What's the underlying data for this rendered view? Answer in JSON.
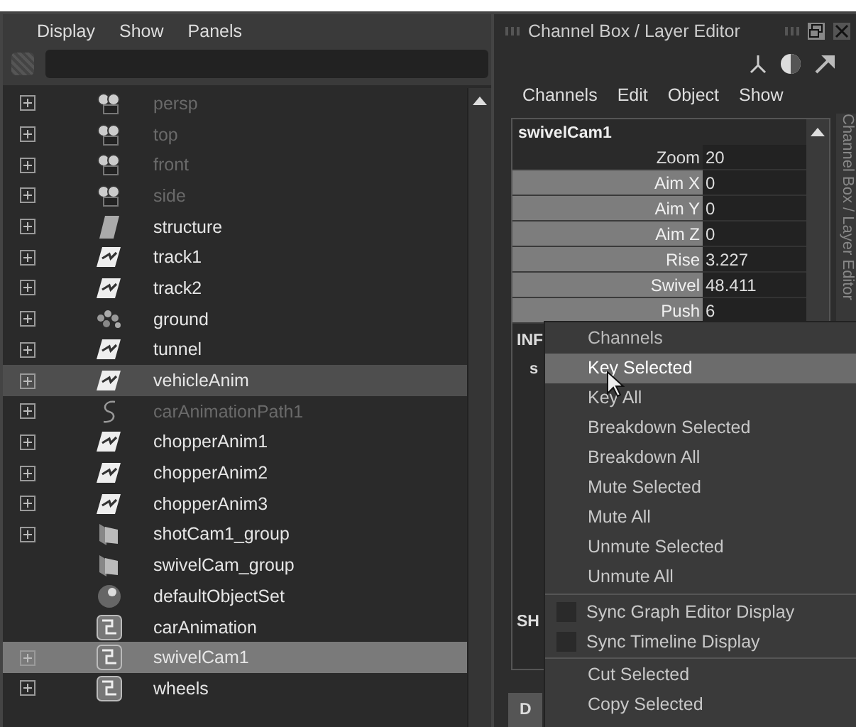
{
  "outliner": {
    "menu": [
      "Display",
      "Show",
      "Panels"
    ],
    "rows": [
      {
        "name": "persp",
        "kind": "camera",
        "expandable": true,
        "dimmed": true,
        "selected": false
      },
      {
        "name": "top",
        "kind": "camera",
        "expandable": true,
        "dimmed": true,
        "selected": false
      },
      {
        "name": "front",
        "kind": "camera",
        "expandable": true,
        "dimmed": true,
        "selected": false
      },
      {
        "name": "side",
        "kind": "camera",
        "expandable": true,
        "dimmed": true,
        "selected": false
      },
      {
        "name": "structure",
        "kind": "surface",
        "expandable": true,
        "dimmed": false,
        "selected": false
      },
      {
        "name": "track1",
        "kind": "transform",
        "expandable": true,
        "dimmed": false,
        "selected": false
      },
      {
        "name": "track2",
        "kind": "transform",
        "expandable": true,
        "dimmed": false,
        "selected": false
      },
      {
        "name": "ground",
        "kind": "particles",
        "expandable": true,
        "dimmed": false,
        "selected": false
      },
      {
        "name": "tunnel",
        "kind": "transform",
        "expandable": true,
        "dimmed": false,
        "selected": false
      },
      {
        "name": "vehicleAnim",
        "kind": "transform",
        "expandable": true,
        "dimmed": false,
        "selected": true
      },
      {
        "name": "carAnimationPath1",
        "kind": "curve",
        "expandable": true,
        "dimmed": true,
        "selected": false
      },
      {
        "name": "chopperAnim1",
        "kind": "transform",
        "expandable": true,
        "dimmed": false,
        "selected": false
      },
      {
        "name": "chopperAnim2",
        "kind": "transform",
        "expandable": true,
        "dimmed": false,
        "selected": false
      },
      {
        "name": "chopperAnim3",
        "kind": "transform",
        "expandable": true,
        "dimmed": false,
        "selected": false
      },
      {
        "name": "shotCam1_group",
        "kind": "group",
        "expandable": true,
        "dimmed": false,
        "selected": false
      },
      {
        "name": "swivelCam_group",
        "kind": "group",
        "expandable": false,
        "dimmed": false,
        "selected": false
      },
      {
        "name": "defaultObjectSet",
        "kind": "set",
        "expandable": false,
        "dimmed": false,
        "selected": false
      },
      {
        "name": "carAnimation",
        "kind": "layer",
        "expandable": false,
        "dimmed": false,
        "selected": false
      },
      {
        "name": "swivelCam1",
        "kind": "layer",
        "expandable": true,
        "dimmed": false,
        "selected": true
      },
      {
        "name": "wheels",
        "kind": "layer",
        "expandable": true,
        "dimmed": false,
        "selected": false
      }
    ]
  },
  "channel_box": {
    "title": "Channel Box / Layer Editor",
    "side_tab": "Channel Box / Layer Editor",
    "menu": [
      "Channels",
      "Edit",
      "Object",
      "Show"
    ],
    "object": "swivelCam1",
    "channels": [
      {
        "name": "Zoom",
        "value": "20",
        "selected": false
      },
      {
        "name": "Aim X",
        "value": "0",
        "selected": true
      },
      {
        "name": "Aim Y",
        "value": "0",
        "selected": true
      },
      {
        "name": "Aim Z",
        "value": "0",
        "selected": true
      },
      {
        "name": "Rise",
        "value": "3.227",
        "selected": true
      },
      {
        "name": "Swivel",
        "value": "48.411",
        "selected": true
      },
      {
        "name": "Push",
        "value": "6",
        "selected": true
      }
    ],
    "inputs_label": "INF",
    "inputs_item": "s",
    "shapes_label": "SH",
    "bottom_tab": "D"
  },
  "context_menu": {
    "items": [
      {
        "kind": "header",
        "label": "Channels"
      },
      {
        "kind": "item",
        "label": "Key Selected",
        "selected": true
      },
      {
        "kind": "item",
        "label": "Key All",
        "selected": false
      },
      {
        "kind": "item",
        "label": "Breakdown Selected",
        "selected": false
      },
      {
        "kind": "item",
        "label": "Breakdown All",
        "selected": false
      },
      {
        "kind": "item",
        "label": "Mute Selected",
        "selected": false
      },
      {
        "kind": "item",
        "label": "Mute All",
        "selected": false
      },
      {
        "kind": "item",
        "label": "Unmute Selected",
        "selected": false
      },
      {
        "kind": "item",
        "label": "Unmute All",
        "selected": false
      },
      {
        "kind": "divider"
      },
      {
        "kind": "check",
        "label": "Sync Graph Editor Display",
        "checked": false
      },
      {
        "kind": "check",
        "label": "Sync Timeline Display",
        "checked": false
      },
      {
        "kind": "divider"
      },
      {
        "kind": "item",
        "label": "Cut Selected",
        "selected": false
      },
      {
        "kind": "item",
        "label": "Copy Selected",
        "selected": false
      }
    ]
  }
}
